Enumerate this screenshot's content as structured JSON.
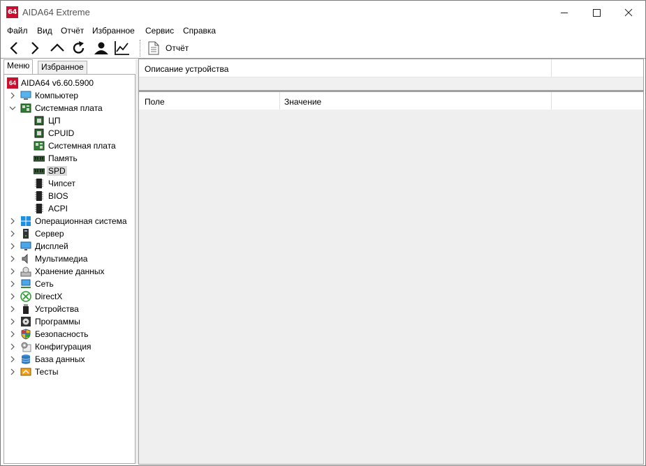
{
  "window": {
    "title": "AIDA64 Extreme",
    "logo_text": "64"
  },
  "menubar": [
    "Файл",
    "Вид",
    "Отчёт",
    "Избранное",
    "Сервис",
    "Справка"
  ],
  "toolbar": {
    "report_label": "Отчёт"
  },
  "tabs": {
    "menu": "Меню",
    "favorites": "Избранное"
  },
  "tree": {
    "root": "AIDA64 v6.60.5900",
    "computer": "Компьютер",
    "motherboard": "Системная плата",
    "motherboard_children": [
      "ЦП",
      "CPUID",
      "Системная плата",
      "Память",
      "SPD",
      "Чипсет",
      "BIOS",
      "ACPI"
    ],
    "selected": "SPD",
    "others": [
      "Операционная система",
      "Сервер",
      "Дисплей",
      "Мультимедиа",
      "Хранение данных",
      "Сеть",
      "DirectX",
      "Устройства",
      "Программы",
      "Безопасность",
      "Конфигурация",
      "База данных",
      "Тесты"
    ]
  },
  "description": {
    "header": "Описание устройства"
  },
  "list": {
    "col_field": "Поле",
    "col_value": "Значение"
  },
  "colors": {
    "logo_red": "#c8102e",
    "selection": "#d9d9d9",
    "pane_bg": "#ececec"
  }
}
